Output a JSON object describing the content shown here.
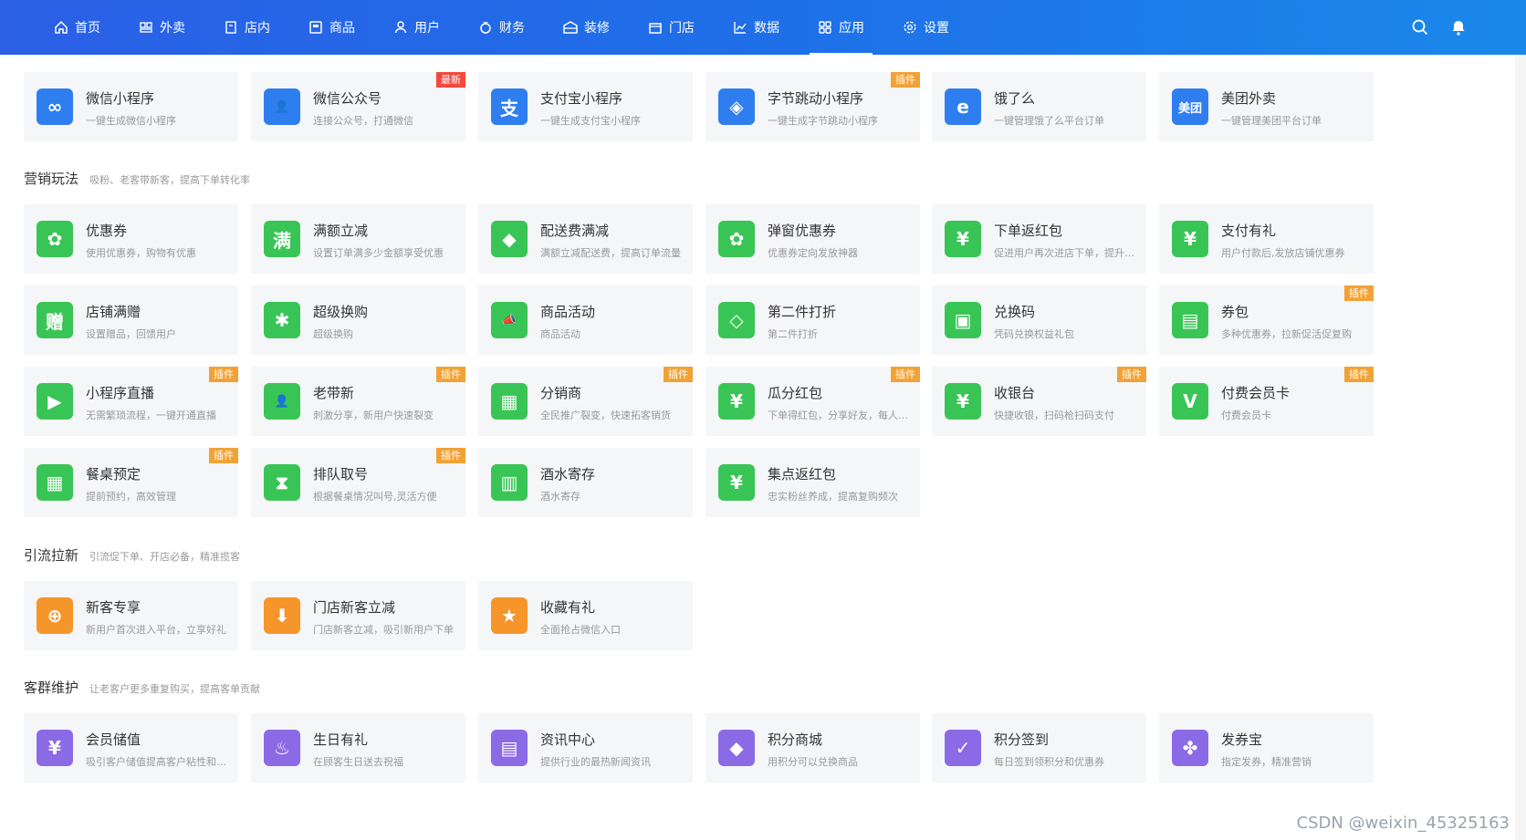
{
  "nav": {
    "items": [
      {
        "label": "首页",
        "icon": "home-icon"
      },
      {
        "label": "外卖",
        "icon": "takeout-icon"
      },
      {
        "label": "店内",
        "icon": "dinein-icon"
      },
      {
        "label": "商品",
        "icon": "goods-icon"
      },
      {
        "label": "用户",
        "icon": "user-icon"
      },
      {
        "label": "财务",
        "icon": "finance-icon"
      },
      {
        "label": "装修",
        "icon": "decor-icon"
      },
      {
        "label": "门店",
        "icon": "store-icon"
      },
      {
        "label": "数据",
        "icon": "chart-icon"
      },
      {
        "label": "应用",
        "icon": "apps-icon",
        "active": true
      },
      {
        "label": "设置",
        "icon": "gear-icon"
      }
    ],
    "right_icons": [
      "search-icon",
      "bell-icon"
    ]
  },
  "channels": [
    {
      "title": "微信小程序",
      "desc": "一键生成微信小程序",
      "color": "#2f7ef0",
      "glyph": "∞"
    },
    {
      "title": "微信公众号",
      "desc": "连接公众号，打通微信",
      "color": "#2f7ef0",
      "glyph": "👤",
      "tag": "最新",
      "tag_type": "new"
    },
    {
      "title": "支付宝小程序",
      "desc": "一键生成支付宝小程序",
      "color": "#2f7ef0",
      "glyph": "支"
    },
    {
      "title": "字节跳动小程序",
      "desc": "一键生成字节跳动小程序",
      "color": "#2f7ef0",
      "glyph": "◈",
      "tag": "插件"
    },
    {
      "title": "饿了么",
      "desc": "一键管理饿了么平台订单",
      "color": "#2f7ef0",
      "glyph": "e"
    },
    {
      "title": "美团外卖",
      "desc": "一键管理美团平台订单",
      "color": "#2f7ef0",
      "glyph": "美团"
    }
  ],
  "sections": {
    "marketing": {
      "title": "营销玩法",
      "subtitle": "吸粉、老客带新客，提高下单转化率"
    },
    "traffic": {
      "title": "引流拉新",
      "subtitle": "引流促下单、开店必备，精准揽客"
    },
    "retention": {
      "title": "客群维护",
      "subtitle": "让老客户更多重复购买，提高客单贡献"
    }
  },
  "marketing_cards": [
    {
      "title": "优惠券",
      "desc": "使用优惠券，购物有优惠",
      "glyph": "✿"
    },
    {
      "title": "满额立减",
      "desc": "设置订单满多少金额享受优惠",
      "glyph": "满"
    },
    {
      "title": "配送费满减",
      "desc": "满额立减配送费，提高订单流量",
      "glyph": "◆"
    },
    {
      "title": "弹窗优惠券",
      "desc": "优惠券定向发放神器",
      "glyph": "✿"
    },
    {
      "title": "下单返红包",
      "desc": "促进用户再次进店下单，提升复购",
      "glyph": "¥"
    },
    {
      "title": "支付有礼",
      "desc": "用户付款后,发放店铺优惠券",
      "glyph": "¥"
    },
    {
      "title": "店铺满赠",
      "desc": "设置赠品，回馈用户",
      "glyph": "赠"
    },
    {
      "title": "超级换购",
      "desc": "超级换购",
      "glyph": "✱"
    },
    {
      "title": "商品活动",
      "desc": "商品活动",
      "glyph": "📣"
    },
    {
      "title": "第二件打折",
      "desc": "第二件打折",
      "glyph": "◇"
    },
    {
      "title": "兑换码",
      "desc": "凭码兑换权益礼包",
      "glyph": "▣"
    },
    {
      "title": "券包",
      "desc": "多种优惠券，拉新促活促复购",
      "glyph": "▤",
      "tag": "插件"
    },
    {
      "title": "小程序直播",
      "desc": "无需繁琐流程，一键开通直播",
      "glyph": "▶",
      "tag": "插件"
    },
    {
      "title": "老带新",
      "desc": "刺激分享，新用户快速裂变",
      "glyph": "👤",
      "tag": "插件"
    },
    {
      "title": "分销商",
      "desc": "全民推广裂变，快速拓客销货",
      "glyph": "▦",
      "tag": "插件"
    },
    {
      "title": "瓜分红包",
      "desc": "下单得红包，分享好友，每人得红包",
      "glyph": "¥",
      "tag": "插件"
    },
    {
      "title": "收银台",
      "desc": "快捷收银，扫码枪扫码支付",
      "glyph": "¥",
      "tag": "插件"
    },
    {
      "title": "付费会员卡",
      "desc": "付费会员卡",
      "glyph": "V",
      "tag": "插件"
    },
    {
      "title": "餐桌预定",
      "desc": "提前预约，高效管理",
      "glyph": "▦",
      "tag": "插件"
    },
    {
      "title": "排队取号",
      "desc": "根据餐桌情况叫号,灵活方便",
      "glyph": "⧗",
      "tag": "插件"
    },
    {
      "title": "酒水寄存",
      "desc": "酒水寄存",
      "glyph": "▥"
    },
    {
      "title": "集点返红包",
      "desc": "忠实粉丝养成，提高复购频次",
      "glyph": "¥"
    }
  ],
  "traffic_cards": [
    {
      "title": "新客专享",
      "desc": "新用户首次进入平台，立享好礼",
      "glyph": "⊕"
    },
    {
      "title": "门店新客立减",
      "desc": "门店新客立减，吸引新用户下单",
      "glyph": "⬇"
    },
    {
      "title": "收藏有礼",
      "desc": "全面抢占微信入口",
      "glyph": "★"
    }
  ],
  "retention_cards": [
    {
      "title": "会员储值",
      "desc": "吸引客户储值提高客户粘性和复购",
      "glyph": "¥"
    },
    {
      "title": "生日有礼",
      "desc": "在顾客生日送去祝福",
      "glyph": "♨"
    },
    {
      "title": "资讯中心",
      "desc": "提供行业的最热新闻资讯",
      "glyph": "▤"
    },
    {
      "title": "积分商城",
      "desc": "用积分可以兑换商品",
      "glyph": "◆"
    },
    {
      "title": "积分签到",
      "desc": "每日签到领积分和优惠券",
      "glyph": "✓"
    },
    {
      "title": "发券宝",
      "desc": "指定发券，精准营销",
      "glyph": "✤"
    }
  ],
  "watermark": "CSDN @weixin_45325163"
}
